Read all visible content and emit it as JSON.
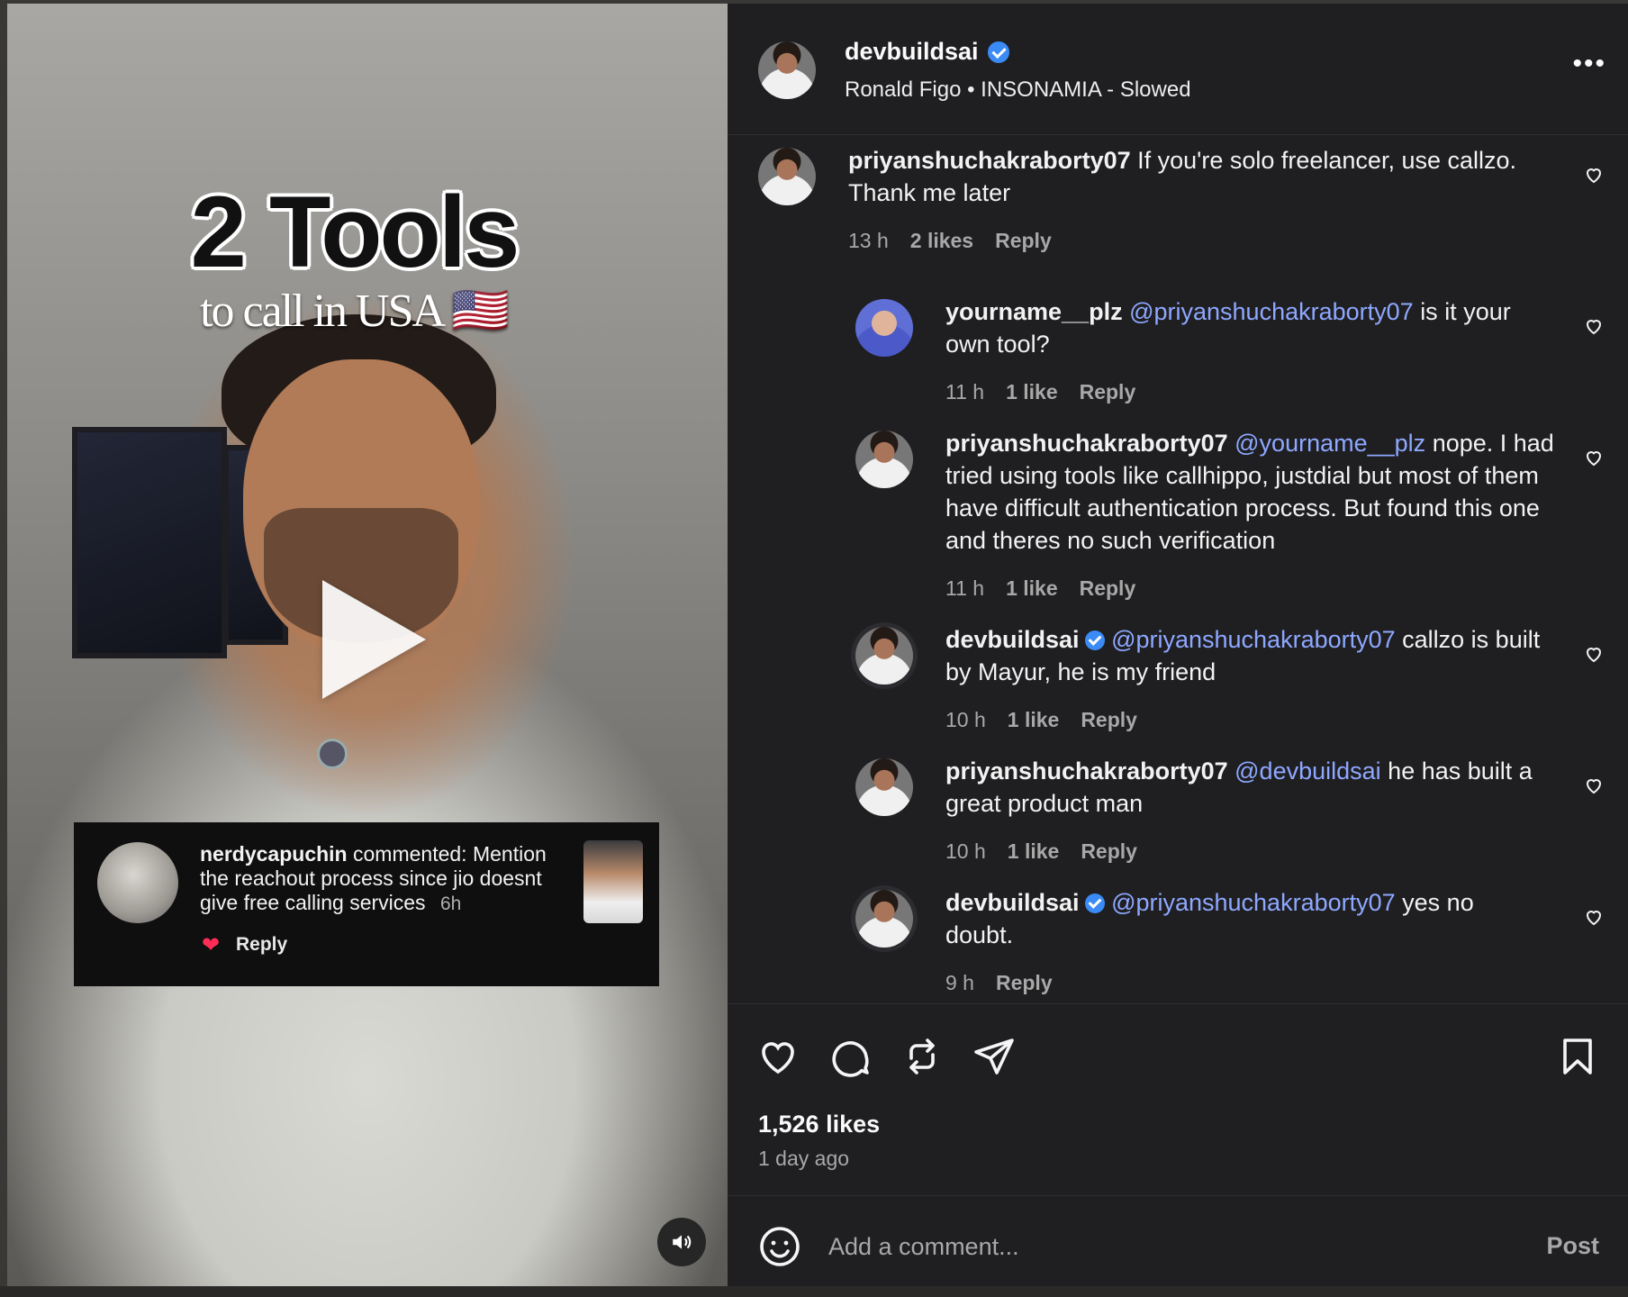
{
  "video": {
    "headline": "2 Tools",
    "subline": "to call in USA 🇺🇸",
    "pinned_comment": {
      "username": "nerdycapuchin",
      "text": "commented: Mention the reachout process since jio doesnt give free calling services",
      "time": "6h",
      "reply_label": "Reply"
    }
  },
  "post": {
    "username": "devbuildsai",
    "audio": "Ronald Figo • INSONAMIA - Slowed",
    "more_label": "•••"
  },
  "comments": [
    {
      "username": "priyanshuchakraborty07",
      "mention": "",
      "text": "If you're solo freelancer, use callzo. Thank me later",
      "time": "13 h",
      "likes": "2 likes",
      "reply": "Reply"
    },
    {
      "username": "yourname__plz",
      "mention": "@priyanshuchakraborty07",
      "text": "is it your own tool?",
      "time": "11 h",
      "likes": "1 like",
      "reply": "Reply"
    },
    {
      "username": "priyanshuchakraborty07",
      "mention": "@yourname__plz",
      "text": "nope. I had tried using tools like callhippo, justdial but most of them have difficult authentication process. But found this one and theres no such verification",
      "time": "11 h",
      "likes": "1 like",
      "reply": "Reply"
    },
    {
      "username": "devbuildsai",
      "mention": "@priyanshuchakraborty07",
      "text": "callzo is built by Mayur, he is my friend",
      "time": "10 h",
      "likes": "1 like",
      "reply": "Reply"
    },
    {
      "username": "priyanshuchakraborty07",
      "mention": "@devbuildsai",
      "text": "he has built a great product man",
      "time": "10 h",
      "likes": "1 like",
      "reply": "Reply"
    },
    {
      "username": "devbuildsai",
      "mention": "@priyanshuchakraborty07",
      "text": "yes no doubt.",
      "time": "9 h",
      "reply": "Reply"
    }
  ],
  "footer": {
    "likes_count": "1,526 likes",
    "posted": "1 day ago",
    "comment_placeholder": "Add a comment...",
    "post_label": "Post"
  },
  "colors": {
    "panel_bg": "#1f1f22",
    "mention": "#8ea8ff",
    "verified": "#3a8bf5",
    "like_red": "#ff2d55"
  }
}
